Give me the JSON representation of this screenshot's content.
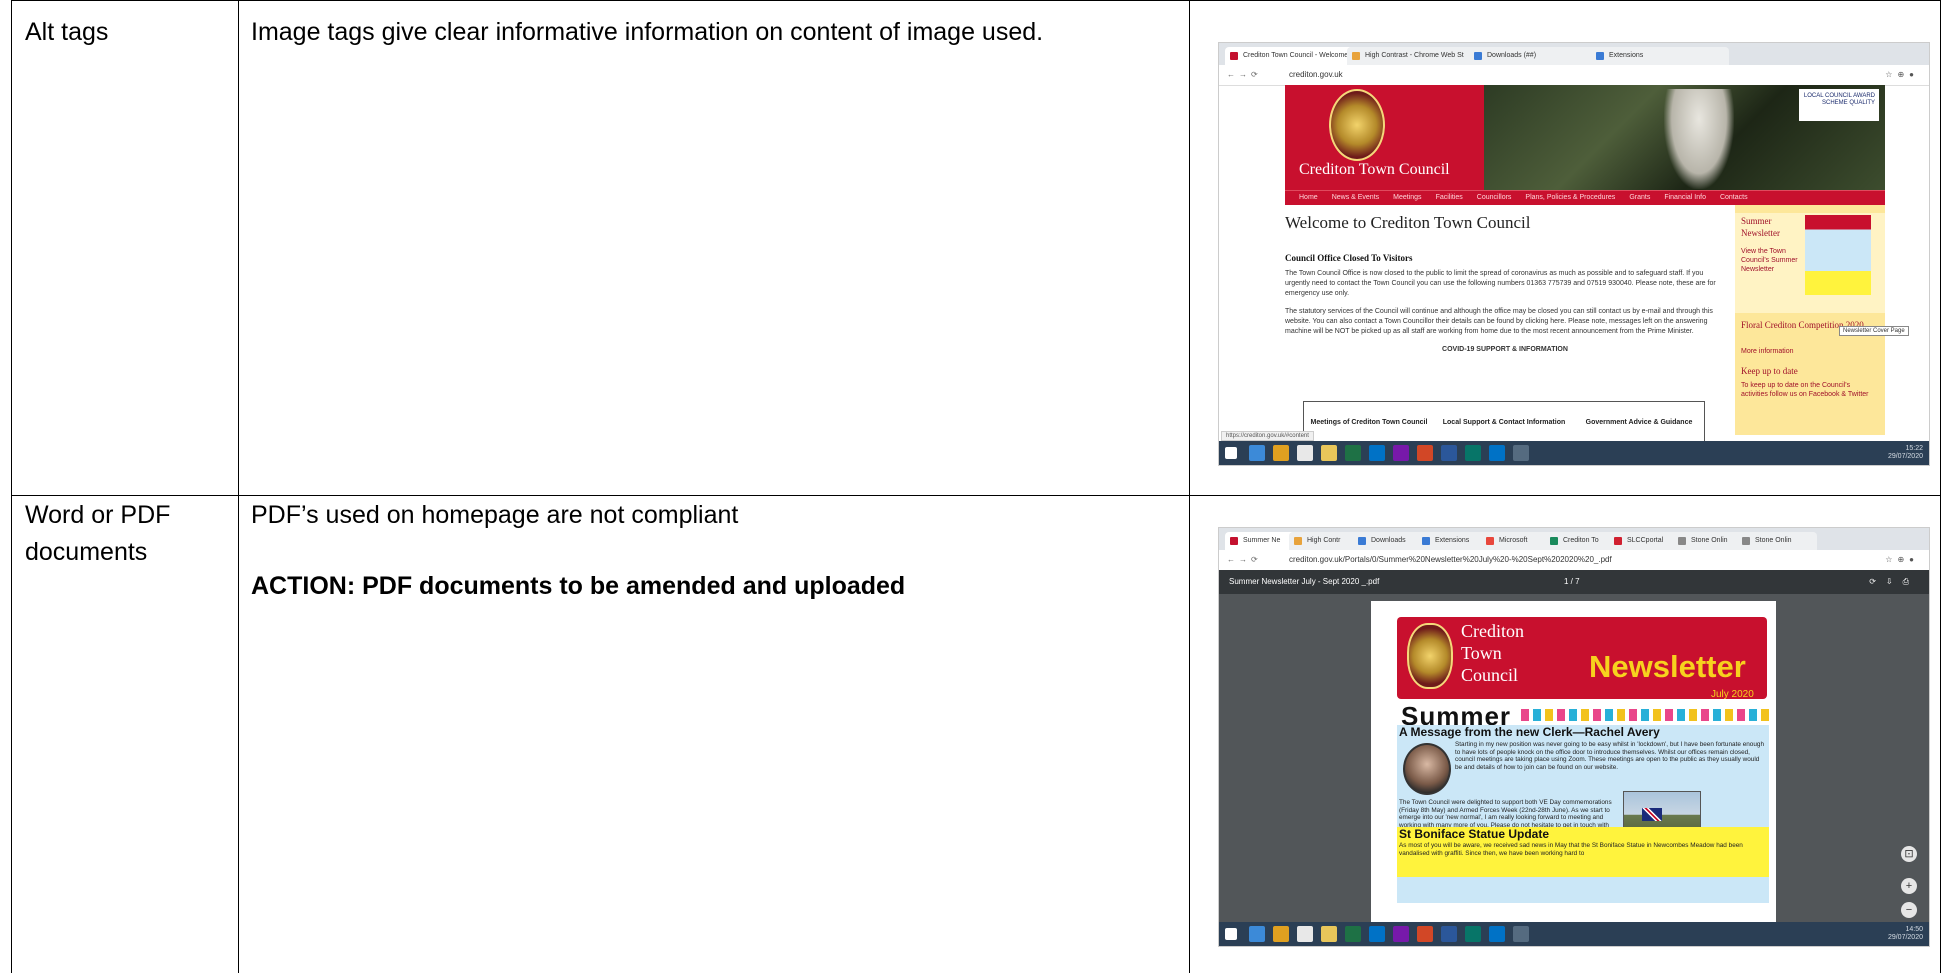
{
  "rows": [
    {
      "label": "Alt tags",
      "description": "Image tags give clear informative information on content of image used."
    },
    {
      "label": "Word or PDF documents",
      "description": "PDF’s used on homepage are not compliant",
      "action": "ACTION: PDF documents to be amended and uploaded"
    }
  ],
  "shot1": {
    "tabs": [
      "Crediton Town Council - Welcome",
      "High Contrast - Chrome Web St",
      "Downloads (##)",
      "Extensions"
    ],
    "url": "crediton.gov.uk",
    "site_title": "Crediton Town Council",
    "quality_badge": "LOCAL COUNCIL AWARD SCHEME QUALITY",
    "nav": [
      "Home",
      "News & Events",
      "Meetings",
      "Facilities",
      "Councillors",
      "Plans, Policies & Procedures",
      "Grants",
      "Financial Info",
      "Contacts"
    ],
    "welcome": "Welcome to Crediton Town Council",
    "notice_heading": "Council Office Closed To Visitors",
    "para1": "The Town Council Office is now closed to the public to limit the spread of coronavirus as much as possible and to safeguard staff. If you urgently need to contact the Town Council you can use the following numbers 01363 775739 and 07519 930040. Please note, these are for emergency use only.",
    "para2": "The statutory services of the Council will continue and although the office may be closed you can still contact us by e-mail and through this website. You can also contact a Town Councillor their details can be found by clicking here. Please note, messages left on the answering machine will be NOT be picked up as all staff are working from home due to the most recent announcement from the Prime Minister.",
    "covid": "COVID-19 SUPPORT & INFORMATION",
    "boxes": [
      "Meetings of Crediton Town Council",
      "Local Support & Contact Information",
      "Government Advice & Guidance"
    ],
    "side": {
      "summer": "Summer Newsletter",
      "view": "View the Town Council's Summer Newsletter",
      "tooltip": "Newsletter Cover Page",
      "floral": "Floral Crediton Competition 2020",
      "more": "More information",
      "keep": "Keep up to date",
      "keep_text": "To keep up to date on the Council's activities follow us on Facebook & Twitter"
    },
    "status_url": "https://crediton.gov.uk/#content",
    "time": "15:22",
    "date": "29/07/2020"
  },
  "shot2": {
    "tabs": [
      "Summer Ne",
      "High Contr",
      "Downloads",
      "Extensions",
      "Microsoft",
      "Crediton To",
      "SLCCportal",
      "Stone Onlin",
      "Stone Onlin"
    ],
    "url": "crediton.gov.uk/Portals/0/Summer%20Newsletter%20July%20-%20Sept%202020%20_.pdf",
    "pdf_title": "Summer Newsletter July - Sept 2020 _.pdf",
    "page_indicator": "1 / 7",
    "nl_town": "Crediton Town Council",
    "nl_word": "Newsletter",
    "nl_date": "July 2020",
    "nl_summer": "Summer",
    "msg_heading": "A Message from the new Clerk—Rachel Avery",
    "msg_p1": "Starting in my new position was never going to be easy whilst in 'lockdown', but I have been fortunate enough to have lots of people knock on the office door to introduce themselves. Whilst our offices remain closed, council meetings are taking place using Zoom. These meetings are open to the public as they usually would be and details of how to join can be found on our website.",
    "msg_p2": "The Town Council were delighted to support both VE Day commemorations (Friday 8th May) and Armed Forces Week (22nd-28th June). As we start to emerge into our 'new normal', I am really looking forward to meeting and working with many more of you. Please do not hesitate to get in touch with me to introduce yourself or if you have a query.",
    "bonif_heading": "St Boniface Statue Update",
    "bonif_text": "As most of you will be aware, we received sad news in May that the St Boniface Statue in Newcombes Meadow had been vandalised with graffiti. Since then, we have been working hard to",
    "time": "14:50",
    "date": "29/07/2020"
  }
}
